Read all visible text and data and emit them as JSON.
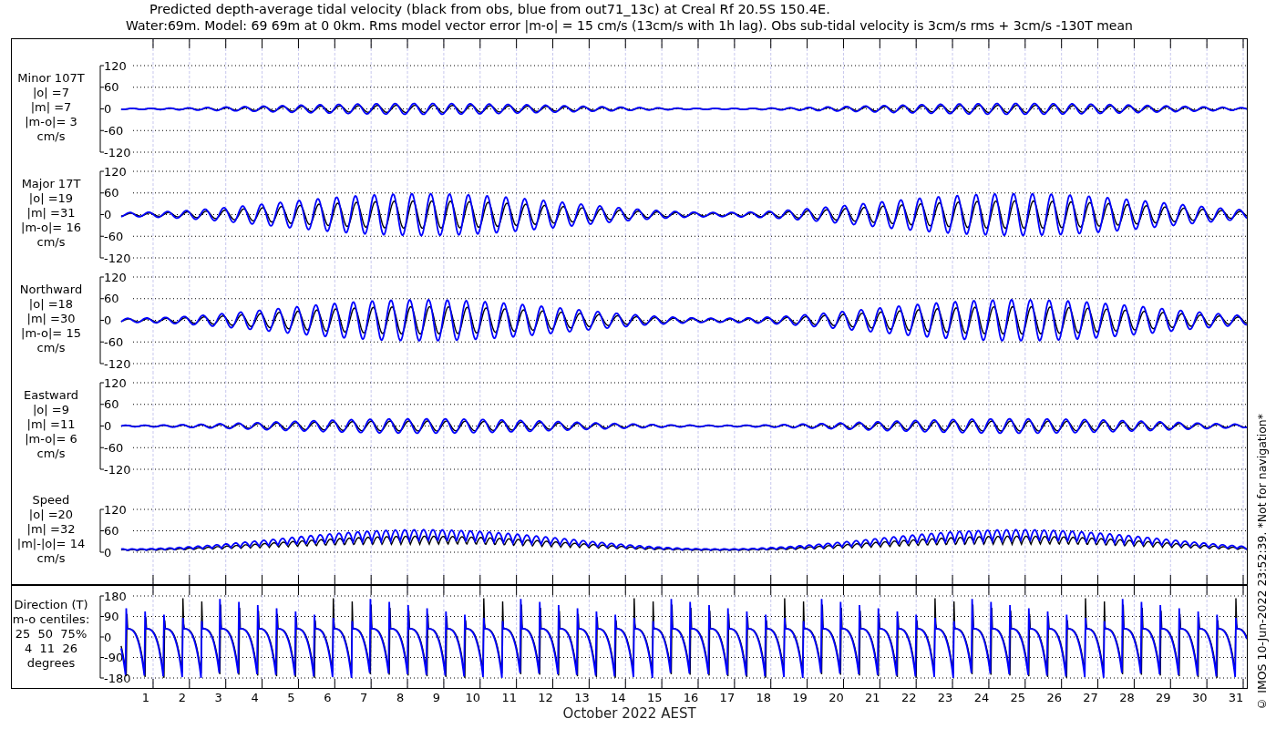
{
  "title_lines": [
    "Predicted depth-average tidal velocity (black from obs, blue from out71_13c) at Creal Rf 20.5S 150.4E.",
    "Water:69m. Model: 69 69m at 0 0km. Rms model vector error |m-o| = 15 cm/s (13cm/s with 1h lag). Obs sub-tidal velocity is 3cm/s rms + 3cm/s -130T mean"
  ],
  "panels": [
    {
      "kind": "signed",
      "label_lines": [
        "Minor 107T",
        "|o| =7",
        "|m| =7",
        "|m-o|= 3",
        "cm/s"
      ],
      "y_tick_labels": [
        "120",
        "60",
        "0",
        "-60",
        "-120"
      ]
    },
    {
      "kind": "signed",
      "label_lines": [
        "Major 17T",
        "|o| =19",
        "|m| =31",
        "|m-o|= 16",
        "cm/s"
      ],
      "y_tick_labels": [
        "120",
        "60",
        "0",
        "-60",
        "-120"
      ]
    },
    {
      "kind": "signed",
      "label_lines": [
        "Northward",
        "|o| =18",
        "|m| =30",
        "|m-o|= 15",
        "cm/s"
      ],
      "y_tick_labels": [
        "120",
        "60",
        "0",
        "-60",
        "-120"
      ]
    },
    {
      "kind": "signed",
      "label_lines": [
        "Eastward",
        "|o| =9",
        "|m| =11",
        "|m-o|= 6",
        "cm/s"
      ],
      "y_tick_labels": [
        "120",
        "60",
        "0",
        "-60",
        "-120"
      ]
    },
    {
      "kind": "speed",
      "label_lines": [
        "Speed",
        "|o| =20",
        "|m| =32",
        "|m|-|o|= 14",
        "cm/s"
      ],
      "y_tick_labels": [
        "120",
        "60",
        "0"
      ]
    },
    {
      "kind": "direction",
      "label_lines": [
        "Direction (T)",
        "m-o centiles:",
        "25  50  75%",
        "4  11  26",
        "degrees"
      ],
      "y_tick_labels": [
        "180",
        "90",
        "0",
        "-90",
        "-180"
      ]
    }
  ],
  "x_tick_labels": [
    "1",
    "2",
    "3",
    "4",
    "5",
    "6",
    "7",
    "8",
    "9",
    "10",
    "11",
    "12",
    "13",
    "14",
    "15",
    "16",
    "17",
    "18",
    "19",
    "20",
    "21",
    "22",
    "23",
    "24",
    "25",
    "26",
    "27",
    "28",
    "29",
    "30",
    "31"
  ],
  "x_axis_title": "October 2022 AEST",
  "footer_note": "© IMOS 10-Jun-2022 23:52:39. *Not for navigation*"
}
